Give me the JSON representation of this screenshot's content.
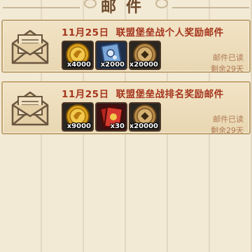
{
  "header": {
    "title": "邮件"
  },
  "mails": [
    {
      "date": "11月25日",
      "subject": "联盟堡垒战个人奖励邮件",
      "status": "邮件已读",
      "remaining": "剩余29天",
      "rewards": [
        {
          "icon": "gold-coin-icon",
          "qty": "x4000"
        },
        {
          "icon": "blue-scroll-icon",
          "qty": "x2000"
        },
        {
          "icon": "bronze-coin-icon",
          "qty": "x20000"
        }
      ]
    },
    {
      "date": "11月25日",
      "subject": "联盟堡垒战排名奖励邮件",
      "status": "邮件已读",
      "remaining": "剩余29天",
      "rewards": [
        {
          "icon": "gold-coin-icon",
          "qty": "x9000"
        },
        {
          "icon": "red-card-icon",
          "qty": "x30"
        },
        {
          "icon": "bronze-coin-icon",
          "qty": "x20000"
        }
      ]
    }
  ],
  "colors": {
    "subject": "#a5351d",
    "status": "#b07a55",
    "card_border": "#c1a574"
  }
}
